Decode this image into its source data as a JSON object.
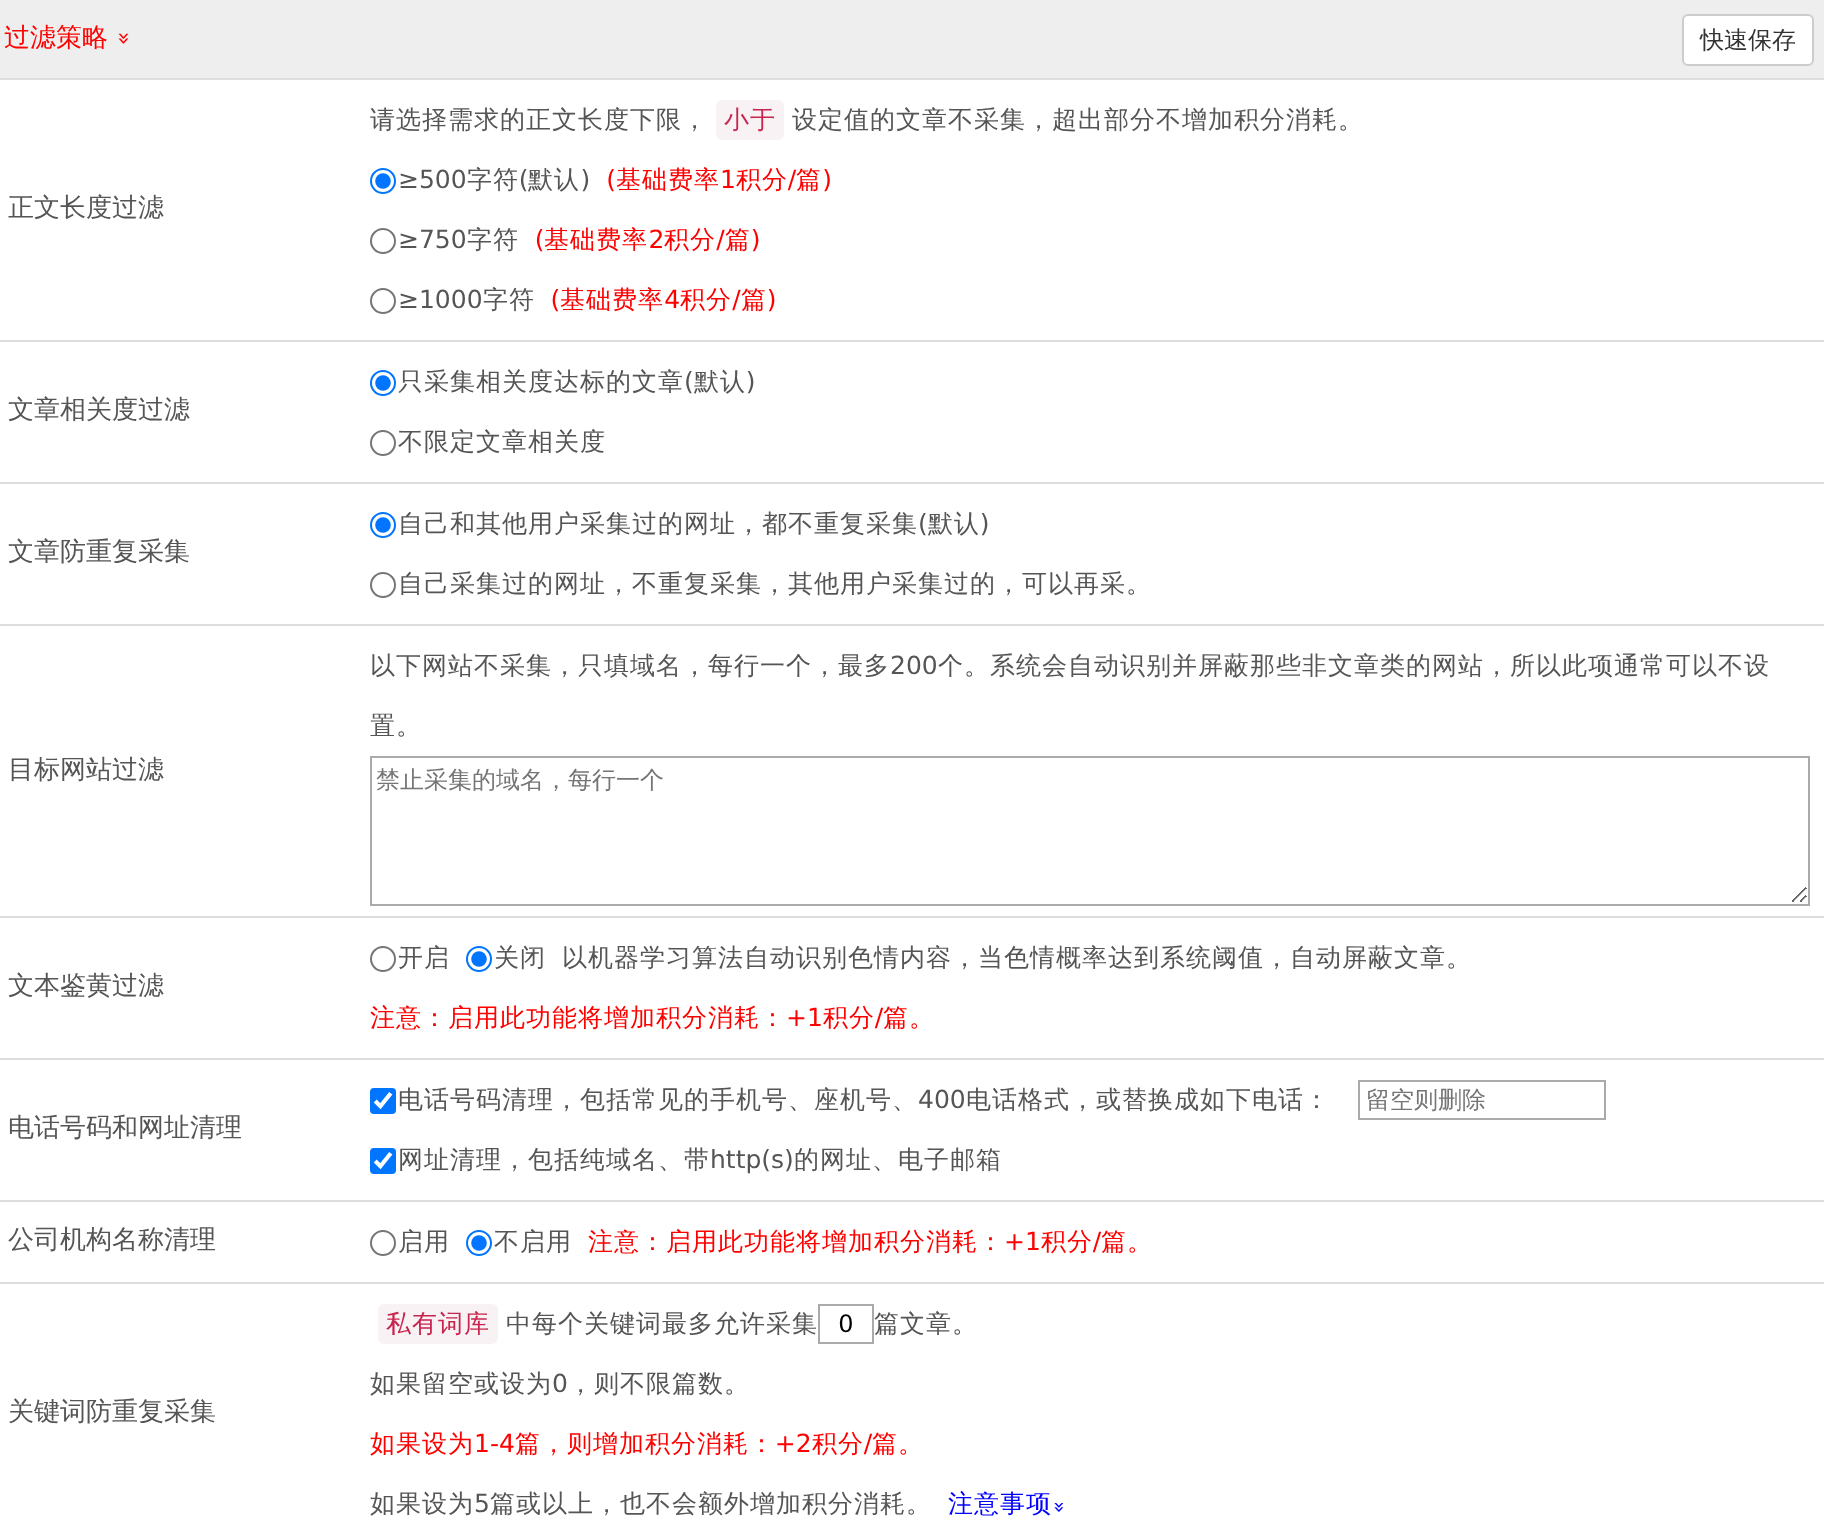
{
  "header": {
    "title": "过滤策略",
    "expand_icon": "»",
    "save_button": "快速保存"
  },
  "sections": [
    {
      "label": "正文长度过滤",
      "lines": [
        [
          {
            "kind": "text",
            "text": "请选择需求的正文长度下限，"
          },
          {
            "kind": "tag",
            "text": "小于"
          },
          {
            "kind": "text",
            "text": "设定值的文章不采集，超出部分不增加积分消耗。"
          }
        ],
        [
          {
            "kind": "radio",
            "text": "≥500字符(默认)",
            "selected": true
          },
          {
            "kind": "note",
            "text": "(基础费率1积分/篇)"
          }
        ],
        [
          {
            "kind": "radio",
            "text": "≥750字符",
            "selected": false
          },
          {
            "kind": "note",
            "text": "(基础费率2积分/篇)"
          }
        ],
        [
          {
            "kind": "radio",
            "text": "≥1000字符",
            "selected": false
          },
          {
            "kind": "note",
            "text": "(基础费率4积分/篇)"
          }
        ]
      ]
    },
    {
      "label": "文章相关度过滤",
      "lines": [
        [
          {
            "kind": "radio",
            "text": "只采集相关度达标的文章(默认)",
            "selected": true
          }
        ],
        [
          {
            "kind": "radio",
            "text": "不限定文章相关度",
            "selected": false
          }
        ]
      ]
    },
    {
      "label": "文章防重复采集",
      "lines": [
        [
          {
            "kind": "radio",
            "text": "自己和其他用户采集过的网址，都不重复采集(默认)",
            "selected": true
          }
        ],
        [
          {
            "kind": "radio",
            "text": "自己采集过的网址，不重复采集，其他用户采集过的，可以再采。",
            "selected": false
          }
        ]
      ]
    },
    {
      "label": "目标网站过滤",
      "lines": [
        [
          {
            "kind": "text",
            "text": "以下网站不采集，只填域名，每行一个，最多200个。系统会自动识别并屏蔽那些非文章类的网站，所以此项通常可以不设置。"
          }
        ],
        [
          {
            "kind": "textarea",
            "placeholder": "禁止采集的域名，每行一个"
          }
        ]
      ]
    },
    {
      "label": "文本鉴黄过滤",
      "lines": [
        [
          {
            "kind": "radio",
            "text": "开启",
            "selected": false
          },
          {
            "kind": "radio",
            "text": "关闭",
            "selected": true
          },
          {
            "kind": "text",
            "text": "以机器学习算法自动识别色情内容，当色情概率达到系统阈值，自动屏蔽文章。"
          }
        ],
        [
          {
            "kind": "note",
            "text": "注意：启用此功能将增加积分消耗：+1积分/篇。"
          }
        ]
      ]
    },
    {
      "label": "电话号码和网址清理",
      "lines": [
        [
          {
            "kind": "checkbox",
            "text": "电话号码清理，包括常见的手机号、座机号、400电话格式，或替换成如下电话：",
            "checked": true
          },
          {
            "kind": "input",
            "placeholder": "留空则删除"
          }
        ],
        [
          {
            "kind": "checkbox",
            "text": "网址清理，包括纯域名、带http(s)的网址、电子邮箱",
            "checked": true
          }
        ]
      ]
    },
    {
      "label": "公司机构名称清理",
      "lines": [
        [
          {
            "kind": "radio",
            "text": "启用",
            "selected": false
          },
          {
            "kind": "radio",
            "text": "不启用",
            "selected": true
          },
          {
            "kind": "note",
            "text": "注意：启用此功能将增加积分消耗：+1积分/篇。"
          }
        ]
      ]
    },
    {
      "label": "关键词防重复采集",
      "lines": [
        [
          {
            "kind": "tag",
            "text": "私有词库"
          },
          {
            "kind": "text",
            "text": "中每个关键词最多允许采集"
          },
          {
            "kind": "number",
            "value": "0"
          },
          {
            "kind": "text",
            "text": "篇文章。"
          }
        ],
        [
          {
            "kind": "text",
            "text": "如果留空或设为0，则不限篇数。"
          }
        ],
        [
          {
            "kind": "note",
            "text": "如果设为1-4篇，则增加积分消耗：+2积分/篇。"
          }
        ],
        [
          {
            "kind": "text",
            "text": "如果设为5篇或以上，也不会额外增加积分消耗。"
          },
          {
            "kind": "link",
            "text": "注意事项",
            "icon": "»"
          }
        ]
      ]
    }
  ]
}
